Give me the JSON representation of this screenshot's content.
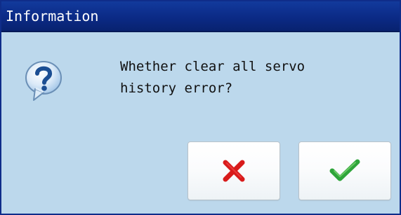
{
  "window": {
    "title": "Information"
  },
  "message": {
    "lines": [
      "Whether clear all servo",
      "history error?"
    ]
  },
  "icons": {
    "question": "question-icon",
    "cancel": "close-icon",
    "confirm": "checkmark-icon"
  },
  "colors": {
    "titlebar": "#0b2a86",
    "title_text": "#ffffff",
    "dialog_background": "#bcd8ec",
    "cancel_icon": "#d81b1b",
    "confirm_icon": "#2ea53a",
    "question_icon": "#1b4e93"
  }
}
